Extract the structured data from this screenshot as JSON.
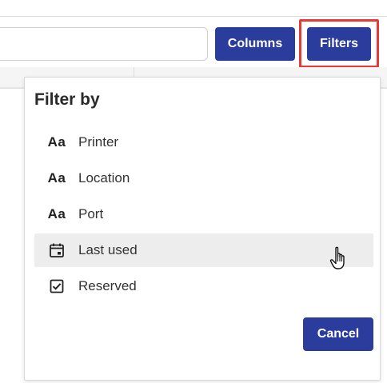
{
  "toolbar": {
    "search_placeholder": "",
    "columns_label": "Columns",
    "filters_label": "Filters",
    "highlight_color": "#e8393a",
    "button_color": "#2b3d9c"
  },
  "filter_panel": {
    "title": "Filter by",
    "items": [
      {
        "label": "Printer",
        "icon": "text-type-icon",
        "glyph": "Aa"
      },
      {
        "label": "Location",
        "icon": "text-type-icon",
        "glyph": "Aa"
      },
      {
        "label": "Port",
        "icon": "text-type-icon",
        "glyph": "Aa"
      },
      {
        "label": "Last used",
        "icon": "calendar-icon",
        "hovered": true
      },
      {
        "label": "Reserved",
        "icon": "checkbox-icon"
      }
    ],
    "cancel_label": "Cancel"
  }
}
